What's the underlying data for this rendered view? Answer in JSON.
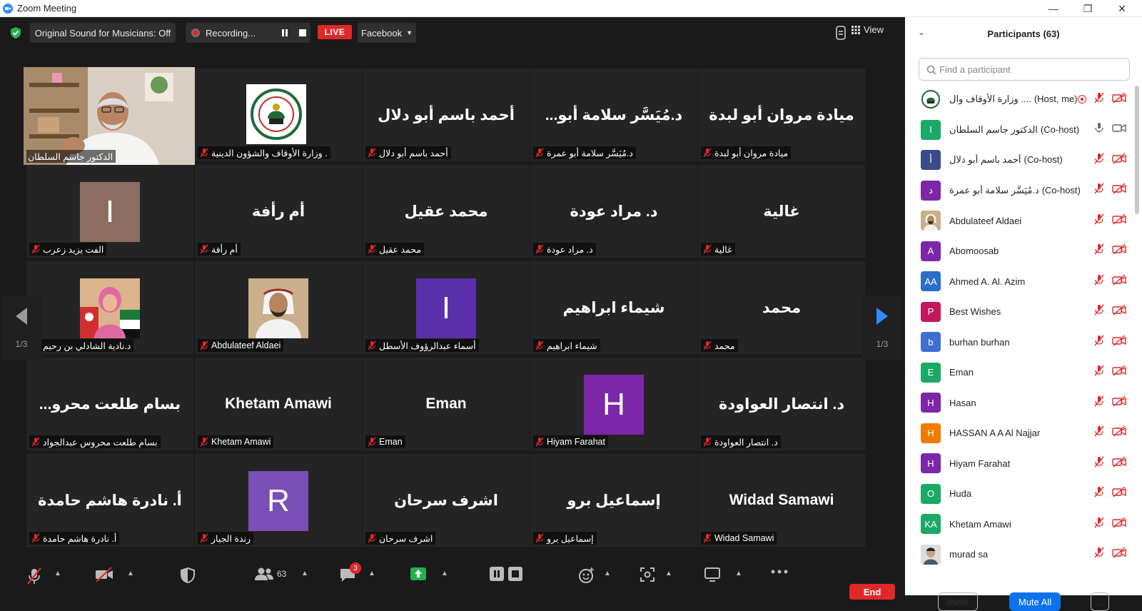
{
  "window": {
    "title": "Zoom Meeting"
  },
  "topbar": {
    "original_sound": "Original Sound for Musicians: Off",
    "recording": "Recording...",
    "live": "LIVE",
    "facebook": "Facebook",
    "view": "View"
  },
  "tiles": [
    {
      "big": "",
      "label": "الدكتور جاسم السلطان",
      "kind": "video",
      "active": true
    },
    {
      "big": "",
      "label": "وزارة الأوقاف والشؤون الدينية .",
      "kind": "logo"
    },
    {
      "big": "أحمد باسم أبو دلال",
      "label": "أحمد باسم أبو دلال",
      "kind": "name"
    },
    {
      "big": "د.مُيَسَّر سلامة أبو...",
      "label": "د.مُيَسَّر سلامة أبو عمرة",
      "kind": "name"
    },
    {
      "big": "ميادة مروان أبو لبدة",
      "label": "ميادة مروان أبو لبدة",
      "kind": "name"
    },
    {
      "big": "I",
      "label": "الفت يزيد زعرب",
      "kind": "letter",
      "color": "#8c6d62"
    },
    {
      "big": "أم رأفة",
      "label": "أم رأفة",
      "kind": "name"
    },
    {
      "big": "محمد عقيل",
      "label": "محمد عقيل",
      "kind": "name"
    },
    {
      "big": "د. مراد عودة",
      "label": "د. مراد عودة",
      "kind": "name"
    },
    {
      "big": "غالية",
      "label": "غالية",
      "kind": "name"
    },
    {
      "big": "",
      "label": "د.نادية الشادلي بن رحيم",
      "kind": "photo-woman"
    },
    {
      "big": "",
      "label": "Abdulateef Aldaei",
      "kind": "photo-man"
    },
    {
      "big": "I",
      "label": "أسماء عبدالرؤوف الأسطل",
      "kind": "letter",
      "color": "#5b2fa9"
    },
    {
      "big": "شيماء ابراهيم",
      "label": "شيماء ابراهيم",
      "kind": "name"
    },
    {
      "big": "محمد",
      "label": "محمد",
      "kind": "name"
    },
    {
      "big": "بسام طلعت محرو...",
      "label": "بسام طلعت محروس عبدالجواد",
      "kind": "name"
    },
    {
      "big": "Khetam Amawi",
      "label": "Khetam Amawi",
      "kind": "name"
    },
    {
      "big": "Eman",
      "label": "Eman",
      "kind": "name"
    },
    {
      "big": "H",
      "label": "Hiyam Farahat",
      "kind": "letter",
      "color": "#7b27a8"
    },
    {
      "big": "د. انتصار العواودة",
      "label": "د. انتصار العواودة",
      "kind": "name"
    },
    {
      "big": "أ. نادرة هاشم حامدة",
      "label": "أ. نادرة هاشم حامدة",
      "kind": "name"
    },
    {
      "big": "R",
      "label": "رندة الجيار",
      "kind": "letter",
      "color": "#7a4fb8"
    },
    {
      "big": "اشرف سرحان",
      "label": "اشرف سرحان",
      "kind": "name"
    },
    {
      "big": "إسماعيل برو",
      "label": "إسماعيل برو",
      "kind": "name"
    },
    {
      "big": "Widad Samawi",
      "label": "Widad Samawi",
      "kind": "name"
    }
  ],
  "pager": {
    "left": "1/3",
    "right": "1/3"
  },
  "toolbar": {
    "participants_count": "63",
    "chat_badge": "3",
    "end": "End"
  },
  "panel": {
    "title": "Participants (63)",
    "search_placeholder": "Find a participant",
    "participants": [
      {
        "name": "وزارة الأوقاف وال ....",
        "role": "(Host, me)",
        "avatar": "logo",
        "color": "#ffffff"
      },
      {
        "name": "الدكتور جاسم السلطان",
        "role": "(Co-host)",
        "avatar": "I",
        "color": "#1aaa66",
        "mic_on": true
      },
      {
        "name": "أحمد باسم أبو دلال",
        "role": "(Co-host)",
        "avatar": "أ",
        "color": "#3d4a8a"
      },
      {
        "name": "د.مُيَسَّر سلامة أبو عمرة",
        "role": "(Co-host)",
        "avatar": "د",
        "color": "#7b27a8"
      },
      {
        "name": "Abdulateef Aldaei",
        "role": "",
        "avatar": "photo",
        "color": "#c9b08a"
      },
      {
        "name": "Abomoosab",
        "role": "",
        "avatar": "A",
        "color": "#7b27a8"
      },
      {
        "name": "Ahmed A. Al. Azim",
        "role": "",
        "avatar": "AA",
        "color": "#2b6ec9"
      },
      {
        "name": "Best Wishes",
        "role": "",
        "avatar": "P",
        "color": "#c2185b"
      },
      {
        "name": "burhan burhan",
        "role": "",
        "avatar": "b",
        "color": "#3f6fd0"
      },
      {
        "name": "Eman",
        "role": "",
        "avatar": "E",
        "color": "#1aaa66"
      },
      {
        "name": "Hasan",
        "role": "",
        "avatar": "H",
        "color": "#7b27a8"
      },
      {
        "name": "HASSAN A A Al Najjar",
        "role": "",
        "avatar": "H",
        "color": "#ef7c00"
      },
      {
        "name": "Hiyam Farahat",
        "role": "",
        "avatar": "H",
        "color": "#7b27a8"
      },
      {
        "name": "Huda",
        "role": "",
        "avatar": "O",
        "color": "#1aaa66"
      },
      {
        "name": "Khetam Amawi",
        "role": "",
        "avatar": "KA",
        "color": "#1aaa66"
      },
      {
        "name": "murad sa",
        "role": "",
        "avatar": "photo2",
        "color": "#8a8a8a"
      }
    ],
    "invite": "Invite",
    "mute_all": "Mute All",
    "more": "..."
  }
}
